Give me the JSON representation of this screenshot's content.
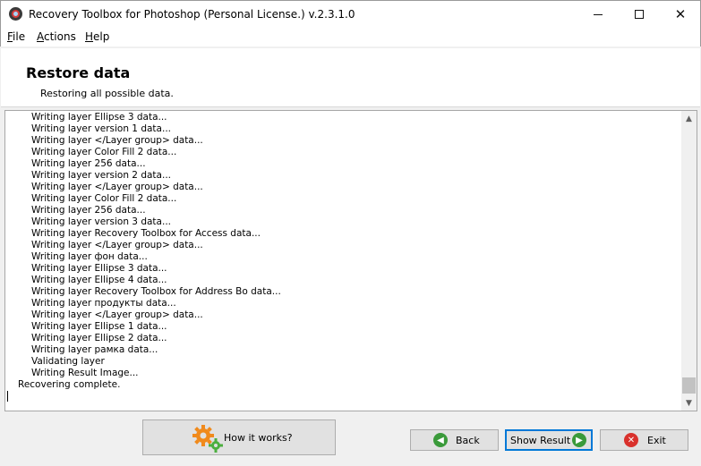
{
  "window": {
    "title": "Recovery Toolbox for Photoshop (Personal License.) v.2.3.1.0",
    "close_symbol": "✕"
  },
  "menu": [
    {
      "label": "File",
      "accel": "F",
      "rest": "ile"
    },
    {
      "label": "Actions",
      "accel": "A",
      "rest": "ctions"
    },
    {
      "label": "Help",
      "accel": "H",
      "rest": "elp"
    }
  ],
  "header": {
    "title": "Restore data",
    "subtitle": "Restoring all possible data."
  },
  "log": {
    "lines": [
      "Writing layer Ellipse 3 data...",
      "Writing layer version 1 data...",
      "Writing layer </Layer group> data...",
      "Writing layer Color Fill 2 data...",
      "Writing layer 256 data...",
      "Writing layer version 2 data...",
      "Writing layer </Layer group> data...",
      "Writing layer Color Fill 2 data...",
      "Writing layer 256 data...",
      "Writing layer version 3 data...",
      "Writing layer Recovery Toolbox for Access data...",
      "Writing layer </Layer group> data...",
      "Writing layer фон data...",
      "Writing layer Ellipse 3 data...",
      "Writing layer Ellipse 4 data...",
      "Writing layer Recovery Toolbox for Address Bo data...",
      "Writing layer продукты data...",
      "Writing layer </Layer group> data...",
      "Writing layer Ellipse 1 data...",
      "Writing layer Ellipse 2 data...",
      "Writing layer рамка data...",
      "Validating layer",
      "Writing Result Image...",
      "Recovering complete."
    ]
  },
  "buttons": {
    "how": "How it works?",
    "back": "Back",
    "show_result": "Show Result",
    "exit": "Exit"
  },
  "icons": {
    "back": "arrow-left-icon",
    "next": "arrow-right-icon",
    "exit": "close-circle-icon",
    "gears": "gears-icon"
  },
  "colors": {
    "accent": "#0078d7",
    "green": "#3a9a3a",
    "red": "#d9312c",
    "orange_gear": "#f08a1c",
    "green_gear": "#4caf3f"
  }
}
